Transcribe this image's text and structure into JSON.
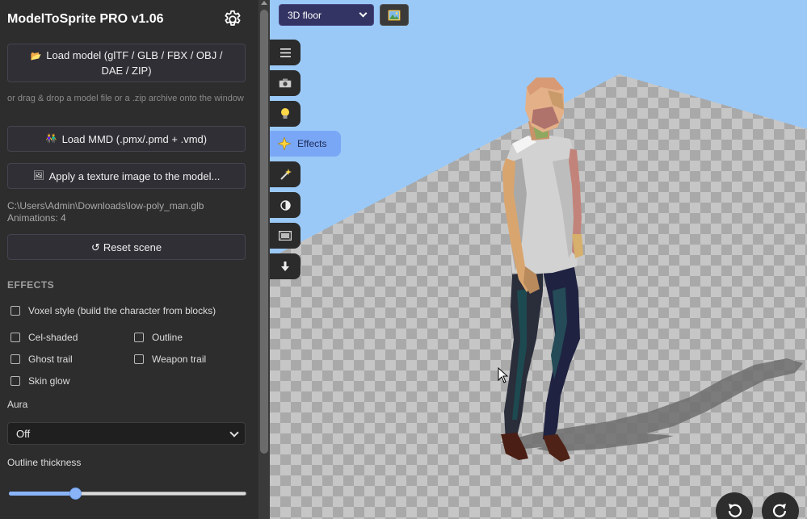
{
  "sidebar": {
    "title": "ModelToSprite PRO v1.06",
    "load_model_label": "Load model (glTF / GLB / FBX / OBJ / DAE / ZIP)",
    "hint": "or drag & drop a model file or a .zip archive onto the window",
    "load_mmd_label": "Load MMD (.pmx/.pmd + .vmd)",
    "apply_texture_label": "Apply a texture image to the model...",
    "file_path": "C:\\Users\\Admin\\Downloads\\low-poly_man.glb",
    "animations": "Animations: 4",
    "reset_label": "Reset scene",
    "effects_title": "EFFECTS",
    "checkboxes": {
      "voxel": "Voxel style (build the character from blocks)",
      "cel": "Cel-shaded",
      "outline": "Outline",
      "ghost": "Ghost trail",
      "weapon": "Weapon trail",
      "glow": "Skin glow"
    },
    "aura_label": "Aura",
    "aura_value": "Off",
    "outline_thickness_label": "Outline thickness",
    "outline_thickness_fraction": 0.27
  },
  "viewport": {
    "view_mode": "3D floor",
    "active_tool_label": "Effects",
    "tools": [
      "menu-icon",
      "camera-icon",
      "light-bulb-icon",
      "effects-sparkle-icon",
      "magic-wand-icon",
      "contrast-icon",
      "filmstrip-icon",
      "download-icon"
    ]
  },
  "colors": {
    "sky": "#9ac9f7",
    "accent": "#7aa7f5",
    "panel": "#2d2d2d",
    "view_select": "#343464"
  }
}
